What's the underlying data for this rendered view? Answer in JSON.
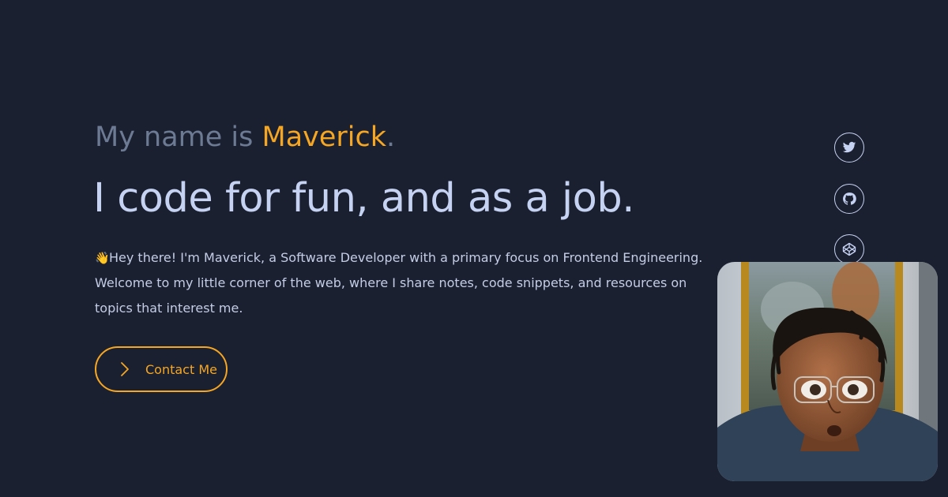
{
  "intro": {
    "prefix": "My name is ",
    "name": "Maverick",
    "suffix": "."
  },
  "headline": "I code for fun, and as a job.",
  "bio": {
    "emoji": "👋",
    "line1": "Hey there! I'm Maverick, a Software Developer with a primary focus on Frontend Engineering.",
    "line2": "Welcome to my little corner of the web, where I share notes, code snippets, and resources on",
    "line3": "topics that interest me."
  },
  "contact": {
    "label": "Contact Me",
    "icon": "chevron-right-icon"
  },
  "social": [
    {
      "icon": "twitter-icon"
    },
    {
      "icon": "github-icon"
    },
    {
      "icon": "codepen-icon"
    }
  ],
  "colors": {
    "background": "#1a2030",
    "accent": "#f5a623",
    "muted": "#6d7a93",
    "text": "#c6d2f2"
  }
}
